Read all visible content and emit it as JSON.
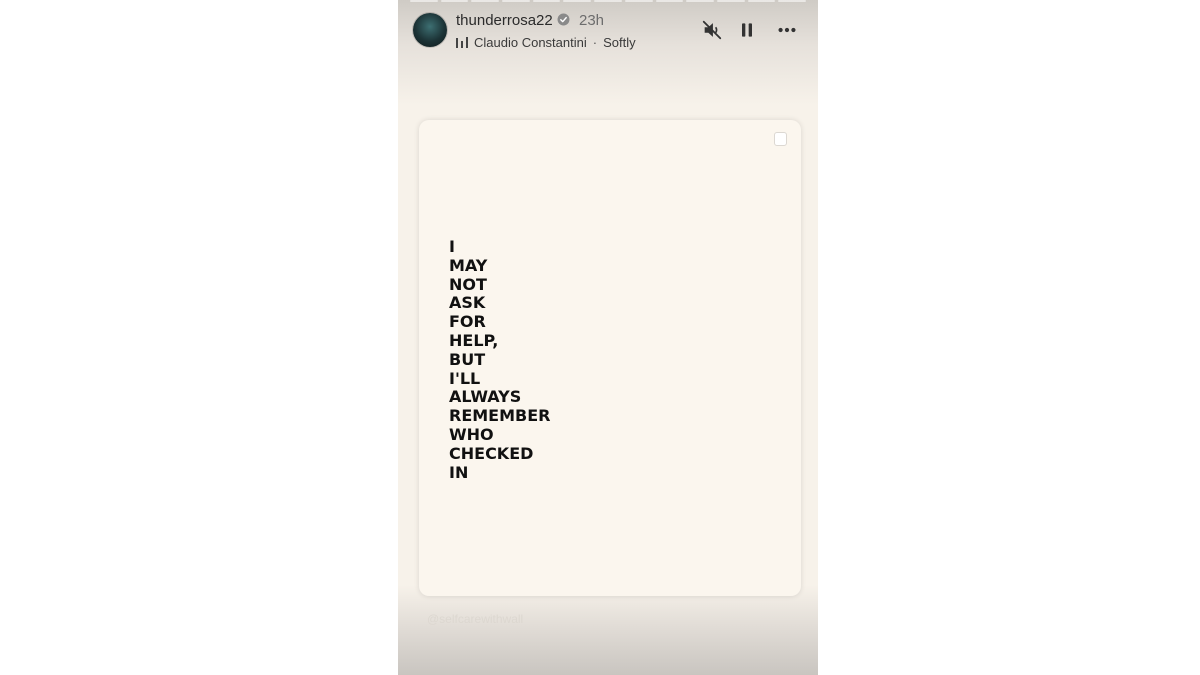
{
  "story": {
    "progress_segments": 13,
    "user": {
      "username": "thunderrosa22",
      "verified": true,
      "time_ago": "23h"
    },
    "music": {
      "artist": "Claudio Constantini",
      "separator": "·",
      "track": "Softly"
    },
    "controls": {
      "mute_icon": "speaker-muted-icon",
      "pause_icon": "pause-icon",
      "more_icon": "more-options-icon"
    },
    "card": {
      "quote_lines": [
        "I",
        "MAY",
        "NOT",
        "ASK",
        "FOR",
        "HELP,",
        "BUT",
        "I'LL",
        "ALWAYS",
        "REMEMBER",
        "WHO",
        "CHECKED",
        "IN"
      ],
      "watermark": "@selfcarewithwall"
    },
    "colors": {
      "background": "#f7f2ea",
      "card": "#fbf6ee",
      "text": "#111111",
      "verified": "#3897f0"
    }
  }
}
